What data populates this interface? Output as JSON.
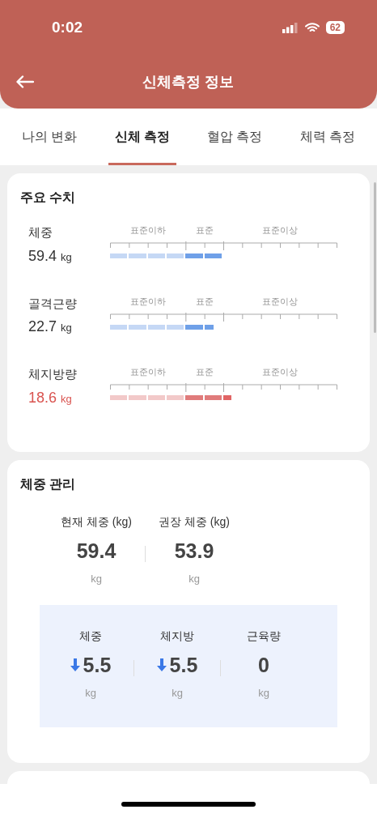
{
  "status_bar": {
    "time": "0:02",
    "battery": "62"
  },
  "header": {
    "title": "신체측정 정보"
  },
  "tabs": [
    {
      "label": "나의 변화",
      "selected": false
    },
    {
      "label": "신체 측정",
      "selected": true
    },
    {
      "label": "혈압 측정",
      "selected": false
    },
    {
      "label": "체력 측정",
      "selected": false
    }
  ],
  "key_figures": {
    "title": "주요 수치",
    "metrics": [
      {
        "label": "체중",
        "value": "59.4",
        "unit": "kg",
        "highlight": false,
        "color": "#6fa0e8",
        "zones": [
          "표준이하",
          "표준",
          "표준이상"
        ]
      },
      {
        "label": "골격근량",
        "value": "22.7",
        "unit": "kg",
        "highlight": false,
        "color": "#6fa0e8",
        "zones": [
          "표준이하",
          "표준",
          "표준이상"
        ]
      },
      {
        "label": "체지방량",
        "value": "18.6",
        "unit": "kg",
        "highlight": true,
        "color": "#e07b7b",
        "zones": [
          "표준이하",
          "표준",
          "표준이상"
        ]
      }
    ]
  },
  "weight_management": {
    "title": "체중 관리",
    "weights": [
      {
        "label": "현재 체중 (kg)",
        "value": "59.4",
        "unit": "kg"
      },
      {
        "label": "권장 체중 (kg)",
        "value": "53.9",
        "unit": "kg"
      }
    ],
    "changes": [
      {
        "label": "체중",
        "kind": "decrease",
        "value": "5.5",
        "unit": "kg"
      },
      {
        "label": "체지방",
        "kind": "decrease",
        "value": "5.5",
        "unit": "kg"
      },
      {
        "label": "근육량",
        "kind": "plain",
        "value": "0",
        "unit": "kg"
      }
    ]
  }
}
